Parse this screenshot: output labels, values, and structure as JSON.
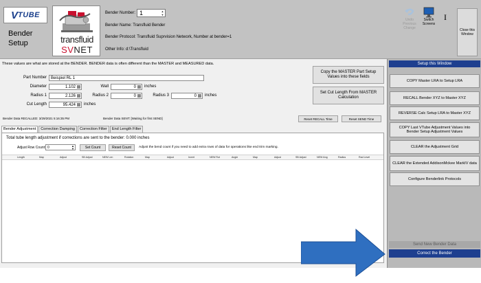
{
  "header": {
    "logo_v": "V",
    "logo_tube": "TUBE",
    "page_title": "Bender Setup",
    "transfluid_word": "transfluid",
    "svnet_sv": "SV",
    "svnet_net": "NET",
    "bender_number_label": "Bender Number:",
    "bender_number_value": "1",
    "bender_name": "Bender Name: Transfluid Bender",
    "bender_protocol": "Bender Protocol: Transfluid Suprvision Network, Number at bender=1",
    "other_info": "Other Info: d:\\Transfluid",
    "undo_label": "Undo Previous Change",
    "switch_label": "Switch Screens",
    "cursor_glyph": "I",
    "close_label": "Close this Window"
  },
  "stored_note": "These values are what are stored at the BENDER.  BENDER data is often different than the MASTER and MEASURED data.",
  "fields": {
    "part_number_label": "Part Number",
    "part_number_value": "Beispiel RL 1",
    "diameter_label": "Diameter",
    "diameter_value": "1.102",
    "wall_label": "Wall",
    "wall_value": "0",
    "wall_unit": "inches",
    "radius1_label": "Radius 1",
    "radius1_value": "2.126",
    "radius2_label": "Radius 2",
    "radius2_value": "0",
    "radius3_label": "Radius 3",
    "radius3_value": "0",
    "radius3_unit": "inches",
    "cut_length_label": "Cut Length",
    "cut_length_value": "95.424",
    "cut_length_unit": "inches"
  },
  "buttons": {
    "copy_master": "Copy the MASTER Part Setup Values into these fields",
    "set_cut_length": "Set Cut Length From MASTER Calculation",
    "reset_recall": "Reset RECALL Time",
    "reset_send": "Reset SEND Time"
  },
  "status": {
    "data_recalled": "Bender Data RECALLED:  3/29/2021 5:16:35 PM",
    "data_sent": "Bender Data SENT:  [Waiting for first SEND]"
  },
  "tabs": [
    "Bender Adjustment",
    "Correction Damping",
    "Correction Filter",
    "End Length Filter"
  ],
  "adjustment": {
    "total_label": "Total tube length adjustment if corrections are sent to the bender:",
    "total_value": "0.000",
    "total_unit": "inches",
    "row_count_label": "Adjust Row Count:",
    "row_count_value": "0",
    "set_count": "Set Count",
    "reset_count": "Reset Count",
    "hint": "Adjust the bend count if you need to add extra rows of data for operations like end trim marking."
  },
  "grid_columns": [
    "Length",
    "Map",
    "Adjust",
    "SB Adjust",
    "NEW Len",
    "Rotation",
    "Map",
    "Adjust",
    "Invert",
    "NEW Rot",
    "Angle",
    "Map",
    "Adjust",
    "SB Adjust",
    "NEW Ang",
    "Radius",
    "Rad Level"
  ],
  "right_panel": {
    "header": "Setup this Window",
    "items": [
      "COPY Master LRA to Setup LRA",
      "RECALL Bender XYZ to Master XYZ",
      "REVERSE Calc Setup LRA to Master XYZ",
      "COPY Last VTube Adjustment Values into Bender Setup Adjustment Values",
      "CLEAR the Adjustment Grid",
      "CLEAR the Extended AddisonMckee MarkIV data",
      "Configure Benderlink Protocols"
    ],
    "send_new": "Send New Bender Data",
    "correct": "Correct the Bender"
  },
  "colors": {
    "accent_blue": "#1e3f8f",
    "arrow_blue": "#2f6fc0",
    "brand_red": "#c8102e"
  }
}
